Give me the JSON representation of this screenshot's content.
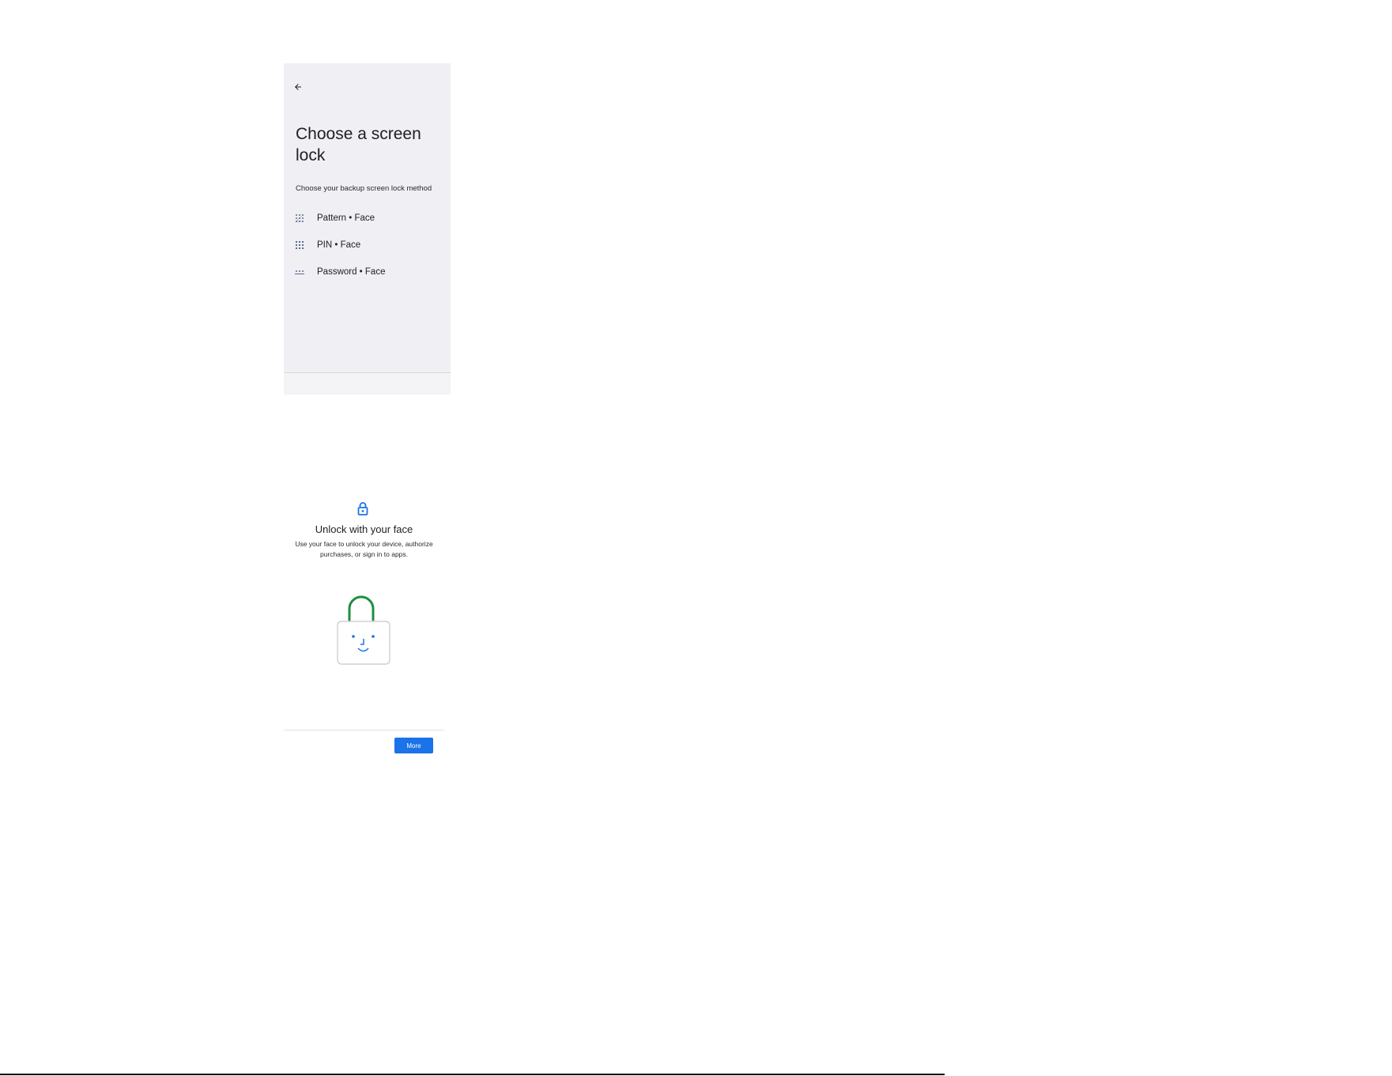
{
  "lock_screen": {
    "back_icon": "arrow-left-icon",
    "title": "Choose a screen lock",
    "subtitle": "Choose your backup screen lock method",
    "options": [
      {
        "icon": "pattern-icon",
        "label": "Pattern • Face"
      },
      {
        "icon": "pin-icon",
        "label": "PIN • Face"
      },
      {
        "icon": "password-icon",
        "label": "Password • Face"
      }
    ]
  },
  "face_screen": {
    "header_icon": "lock-icon",
    "title": "Unlock with your face",
    "description": "Use your face to unlock your device, authorize purchases, or sign in to apps.",
    "illustration": "unlocked-padlock-face-icon",
    "more_label": "More"
  },
  "colors": {
    "accent": "#1a73e8",
    "shackle": "#1e8e3e",
    "panel_background": "#efeff4"
  }
}
